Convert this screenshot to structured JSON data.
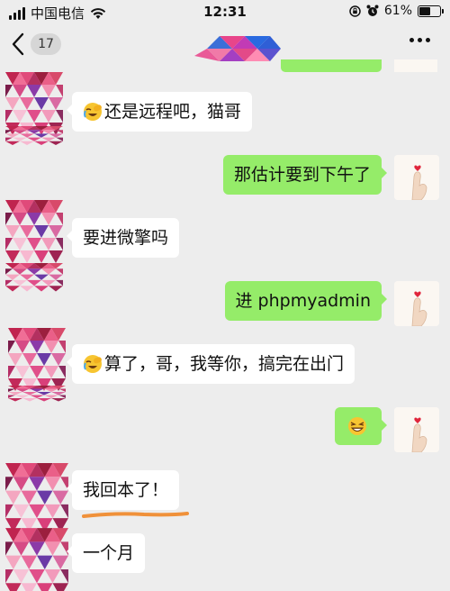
{
  "status_bar": {
    "carrier": "中国电信",
    "time": "12:31",
    "battery_percent": "61%",
    "battery_level": 0.61
  },
  "nav": {
    "unread_count": "17"
  },
  "messages": [
    {
      "side": "in",
      "text": "还是远程吧，猫哥",
      "emoji": "facepalm-laugh-emoji"
    },
    {
      "side": "out",
      "text": "那估计要到下午了"
    },
    {
      "side": "in",
      "text": "要进微擎吗"
    },
    {
      "side": "out",
      "text": "进 phpmyadmin"
    },
    {
      "side": "in",
      "text": "算了，哥，我等你，搞完在出门",
      "emoji": "facepalm-laugh-emoji"
    },
    {
      "side": "out",
      "text": "",
      "emoji": "grin-emoji"
    },
    {
      "side": "in",
      "text": "我回本了！"
    },
    {
      "side": "in",
      "text": "一个月"
    }
  ],
  "colors": {
    "background": "#ededed",
    "outgoing_bubble": "#95ec69",
    "incoming_bubble": "#ffffff",
    "highlight_underline": "#f0913a"
  }
}
